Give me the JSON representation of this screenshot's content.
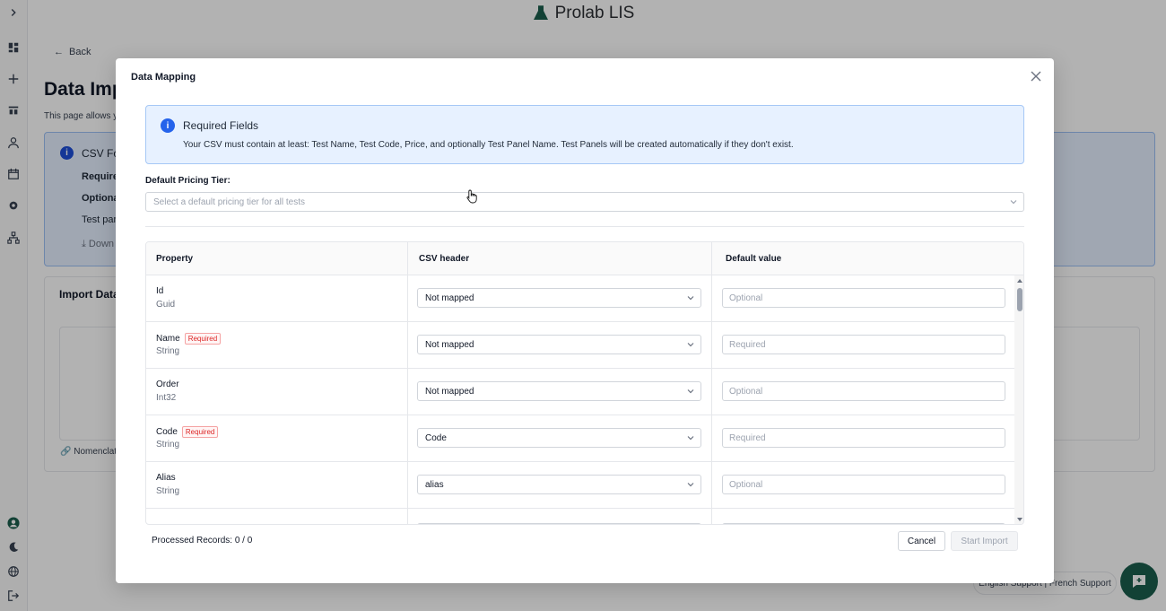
{
  "app": {
    "title": "Prolab LIS"
  },
  "background": {
    "back_label": "Back",
    "page_title": "Data Imp",
    "page_desc": "This page allows y",
    "info_title": "CSV For",
    "info_required": "Require",
    "info_optional": "Optional",
    "info_test": "Test pane",
    "info_download": "Down",
    "import_title": "Import Data",
    "nomenclature": "Nomenclat",
    "support": "English Support | French Support"
  },
  "modal": {
    "title": "Data Mapping",
    "alert": {
      "title": "Required Fields",
      "message": "Your CSV must contain at least: Test Name, Test Code, Price, and optionally Test Panel Name. Test Panels will be created automatically if they don't exist."
    },
    "pricing_tier": {
      "label": "Default Pricing Tier:",
      "placeholder": "Select a default pricing tier for all tests"
    },
    "table": {
      "headers": {
        "property": "Property",
        "csv_header": "CSV header",
        "default_value": "Default value"
      },
      "rows": [
        {
          "name": "Id",
          "type": "Guid",
          "required": false,
          "csv": "Not mapped",
          "default_placeholder": "Optional"
        },
        {
          "name": "Name",
          "type": "String",
          "required": true,
          "csv": "Not mapped",
          "default_placeholder": "Required"
        },
        {
          "name": "Order",
          "type": "Int32",
          "required": false,
          "csv": "Not mapped",
          "default_placeholder": "Optional"
        },
        {
          "name": "Code",
          "type": "String",
          "required": true,
          "csv": "Code",
          "default_placeholder": "Required"
        },
        {
          "name": "Alias",
          "type": "String",
          "required": false,
          "csv": "alias",
          "default_placeholder": "Optional"
        }
      ],
      "required_badge": "Required"
    },
    "processed": "Processed Records: 0 / 0",
    "cancel": "Cancel",
    "start_import": "Start Import"
  }
}
